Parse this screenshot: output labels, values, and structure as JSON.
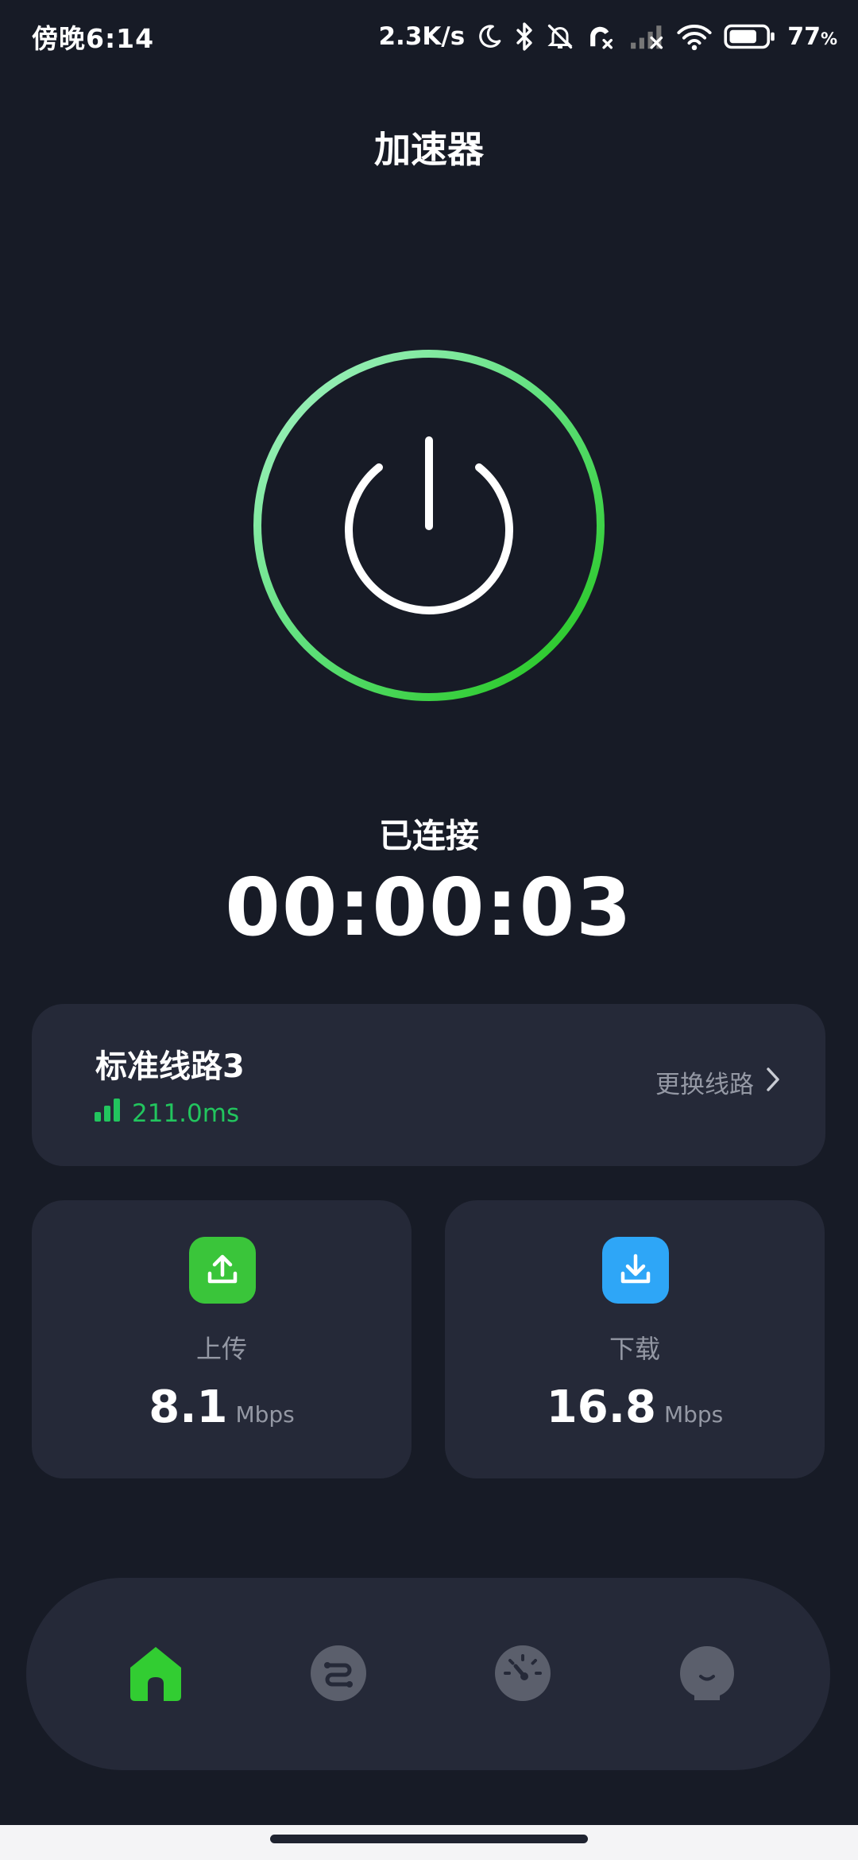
{
  "status_bar": {
    "time": "傍晚6:14",
    "net_speed": "2.3K/s",
    "battery_percent": "77",
    "battery_percent_sign": "%",
    "battery_level": 0.77,
    "icons": [
      "moon-icon",
      "bluetooth-icon",
      "bell-off-icon",
      "phone-missed-icon",
      "signal-off-icon",
      "wifi-icon",
      "battery-icon"
    ]
  },
  "header": {
    "title": "加速器"
  },
  "connection": {
    "state": "已连接",
    "elapsed": "00:00:03",
    "ring_gradient": [
      "#86efac",
      "#22c55e"
    ]
  },
  "route": {
    "name": "标准线路3",
    "latency": "211.0ms",
    "switch_label": "更换线路"
  },
  "upload": {
    "label": "上传",
    "value": "8.1",
    "unit": "Mbps",
    "color": "#3ac53a"
  },
  "download": {
    "label": "下载",
    "value": "16.8",
    "unit": "Mbps",
    "color": "#2ea6f7"
  },
  "nav": {
    "items": [
      {
        "icon": "home-icon",
        "active": true
      },
      {
        "icon": "routes-icon",
        "active": false
      },
      {
        "icon": "speedometer-icon",
        "active": false
      },
      {
        "icon": "profile-icon",
        "active": false
      }
    ],
    "active_color": "#32cd32",
    "inactive_color": "#5b5f6c"
  }
}
